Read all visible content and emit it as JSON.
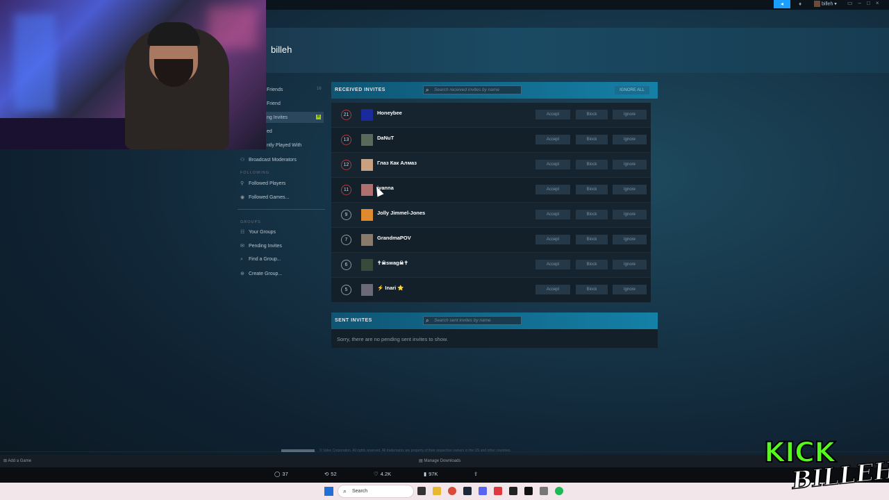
{
  "topbar": {
    "username": "billeh"
  },
  "page": {
    "title": "billeh"
  },
  "sidebar": {
    "friends_count": "16",
    "items": [
      {
        "label": "Friends",
        "icon": "friends-icon"
      },
      {
        "label": "Friend",
        "icon": "add-friend-icon"
      },
      {
        "label": "ng Invites",
        "icon": "pending-invites-icon"
      },
      {
        "label": "ed",
        "icon": "blocked-icon"
      },
      {
        "label": "ntly Played With",
        "icon": "recent-icon"
      },
      {
        "label": "Broadcast Moderators",
        "icon": "moderator-icon"
      }
    ],
    "pending_badge": "8",
    "following_header": "FOLLOWING",
    "following": [
      {
        "label": "Followed Players",
        "icon": "followed-players-icon"
      },
      {
        "label": "Followed Games...",
        "icon": "followed-games-icon"
      }
    ],
    "groups_header": "GROUPS",
    "groups": [
      {
        "label": "Your Groups",
        "icon": "groups-icon"
      },
      {
        "label": "Pending Invites",
        "icon": "mail-icon"
      },
      {
        "label": "Find a Group...",
        "icon": "search-icon"
      },
      {
        "label": "Create Group...",
        "icon": "plus-icon"
      }
    ]
  },
  "received": {
    "title": "RECEIVED INVITES",
    "search_placeholder": "Search received invites by name",
    "ignore_all": "IGNORE ALL",
    "buttons": {
      "accept": "Accept",
      "block": "Block",
      "ignore": "Ignore"
    },
    "invites": [
      {
        "level": "21",
        "name": "Honeybee",
        "avatar_color": "#1b2a9a"
      },
      {
        "level": "13",
        "name": "DaNuT",
        "avatar_color": "#5a6a5a"
      },
      {
        "level": "12",
        "name": "Глаз Как Алмаз",
        "avatar_color": "#c9a080"
      },
      {
        "level": "11",
        "name": "ivanna",
        "avatar_color": "#b07070"
      },
      {
        "level": "9",
        "name": "Jolly Jimmel-Jones",
        "avatar_color": "#e08a30"
      },
      {
        "level": "7",
        "name": "GrandmaPOV",
        "avatar_color": "#8a7a6a"
      },
      {
        "level": "6",
        "name": "✝☠swag☠✝",
        "avatar_color": "#3a4a3a"
      },
      {
        "level": "5",
        "name": "⚡ Inari ⭐",
        "avatar_color": "#6a6a7a"
      }
    ]
  },
  "sent": {
    "title": "SENT INVITES",
    "search_placeholder": "Search sent invites by name",
    "empty_text": "Sorry, there are no pending sent invites to show."
  },
  "footer": {
    "copyright": "© Valve Corporation. All rights reserved. All trademarks are property of their respective owners in the US and other countries.",
    "add_game": "Add a Game",
    "manage_downloads": "Manage Downloads"
  },
  "stream_stats": {
    "comments": "37",
    "reposts": "52",
    "likes": "4.2K",
    "views": "97K"
  },
  "taskbar": {
    "search": "Search"
  },
  "overlay": {
    "kick": "KICK",
    "billeh": "BILLEH"
  }
}
